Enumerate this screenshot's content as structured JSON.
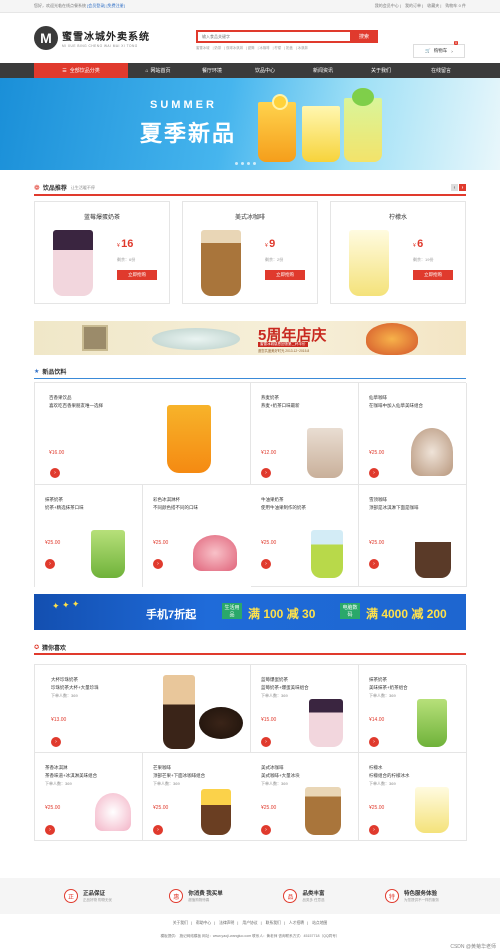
{
  "topbar": {
    "welcome": "您好，欢迎光临在线点餐系统",
    "login": "[会员登录]",
    "register": "[免费注册]",
    "links": [
      "我的会员中心",
      "我的订单",
      "收藏夹",
      "购物车 0 件"
    ]
  },
  "header": {
    "logo_letter": "M",
    "site_name": "蜜雪冰城外卖系统",
    "site_name_en": "MI XUE BING CHENG WAI MAI XI TONG",
    "search_placeholder": "输入食品关键字",
    "search_button": "搜索",
    "hot_words": [
      "蜜雪冰城",
      "奶茶",
      "双球冰淇淋",
      "甜筒",
      "冰咖啡",
      "柠檬",
      "奶盖",
      "冰淇淋"
    ],
    "cart_label": "购物车",
    "cart_count": "0"
  },
  "nav": {
    "all": "全部饮品分类",
    "items": [
      "网站首页",
      "餐厅环境",
      "饮品中心",
      "新闻资讯",
      "关于我们",
      "在线留言"
    ]
  },
  "banner": {
    "summer": "SUMMER",
    "title": "夏季新品"
  },
  "recommend": {
    "title": "饮品推荐",
    "subtitle": "让生活暖不停",
    "items": [
      {
        "name": "蓝莓爆蛋奶茶",
        "price": "16",
        "stock": "剩余：6份",
        "buy": "立即抢购"
      },
      {
        "name": "美式冰咖啡",
        "price": "9",
        "stock": "剩余：2份",
        "buy": "立即抢购"
      },
      {
        "name": "柠檬水",
        "price": "6",
        "stock": "剩余：19份",
        "buy": "立即抢购"
      }
    ]
  },
  "ad_anniversary": {
    "title": "5周年店庆",
    "line1": "蜜雪冰城感恩回馈第二杯半价",
    "line2": "邀您共度美好时光 2013.12~2015.8"
  },
  "new_drinks": {
    "title": "新品饮料",
    "featured": {
      "line1": "百香果饮品",
      "line2": "喜欢吃百香果朋友唯一选择",
      "price": "¥16.00"
    },
    "items": [
      {
        "line1": "燕麦奶茶",
        "line2": "燕麦+奶茶口味最新",
        "price": "¥12.00"
      },
      {
        "line1": "仙草咖啡",
        "line2": "在咖啡中加入仙草美味组合",
        "price": "¥25.00"
      },
      {
        "line1": "抹茶奶茶",
        "line2": "奶茶+精选抹茶口味",
        "price": "¥25.00"
      },
      {
        "line1": "彩色冰淇淋杯",
        "line2": "不同颜色搭不同的口味",
        "price": "¥25.00"
      },
      {
        "line1": "牛油果奶茶",
        "line2": "使用牛油果制作的奶茶",
        "price": "¥25.00"
      },
      {
        "line1": "雪顶咖啡",
        "line2": "顶部是冰淇淋下面是咖啡",
        "price": "¥25.00"
      }
    ]
  },
  "ad_mobile": {
    "slogan": "手机7折起",
    "tag1": "生活用品",
    "deal1": "满 100 减 30",
    "tag2": "电脑数码",
    "deal2": "满 4000 减 200"
  },
  "like": {
    "title": "猜你喜欢",
    "items": [
      {
        "line1": "大杯珍珠奶茶",
        "line2": "珍珠奶茶大杯+大量珍珠",
        "sales": "下单人数：369",
        "price": "¥13.00"
      },
      {
        "line1": "蓝莓爆蛋奶茶",
        "line2": "蓝莓奶茶+爆蛋美味组合",
        "sales": "下单人数：369",
        "price": "¥15.00"
      },
      {
        "line1": "抹茶奶茶",
        "line2": "美味抹茶+奶茶组合",
        "sales": "下单人数：369",
        "price": "¥14.00"
      },
      {
        "line1": "茶香冰淇淋",
        "line2": "茶香味道+冰淇淋美味组合",
        "sales": "下单人数：369",
        "price": "¥25.00"
      },
      {
        "line1": "芒果咖啡",
        "line2": "顶部芒果+下面冰咖啡组合",
        "sales": "下单人数：369",
        "price": "¥25.00"
      },
      {
        "line1": "美式冰咖啡",
        "line2": "美式咖啡+大量冰块",
        "sales": "下单人数：369",
        "price": "¥25.00"
      },
      {
        "line1": "柠檬水",
        "line2": "柠檬组合的柠檬冰水",
        "sales": "下单人数：369",
        "price": "¥25.00"
      }
    ]
  },
  "services": [
    {
      "icon": "正",
      "title": "正品保证",
      "sub": "正品好物 购物无忧"
    },
    {
      "icon": "惠",
      "title": "你消费 我买单",
      "sub": "超值购物惊喜"
    },
    {
      "icon": "品",
      "title": "品类丰富",
      "sub": "品类多 任意选"
    },
    {
      "icon": "特",
      "title": "特色服务体验",
      "sub": "为您提供不一样的服务"
    }
  ],
  "footer": {
    "links": [
      "关于我们",
      "帮助中心",
      "法律声明",
      "用户协议",
      "联系我们",
      "人才招聘",
      "站点地图"
    ],
    "copyright": "模板提供：   施记网络模板    网址：www.yaoji-wangluo.com    联系人：黄老师    咨询联系方式：45157718（QQ同号）",
    "watermark": "CSDN @黄菊华老师"
  },
  "colors": {
    "accent": "#e03a2d",
    "nav_bg": "#3b3b3b",
    "link": "#2f6fc6"
  }
}
